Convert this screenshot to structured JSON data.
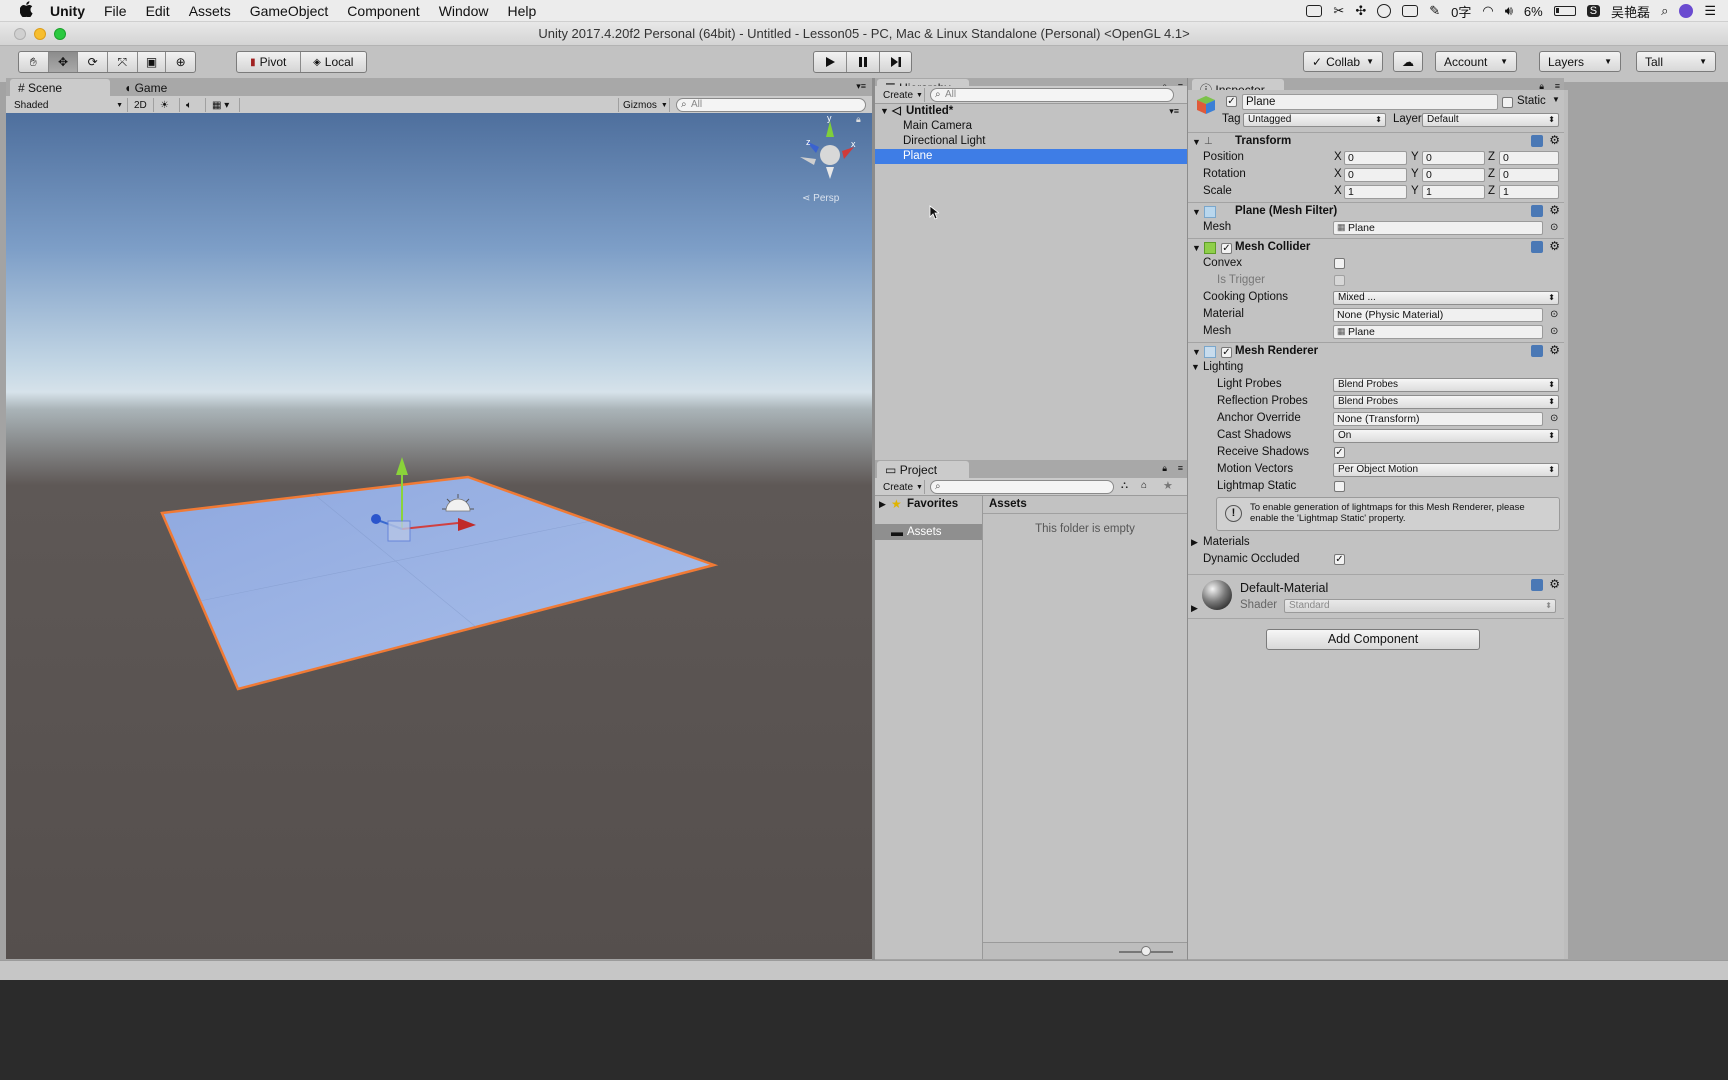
{
  "menubar": {
    "apple": "",
    "items": [
      "Unity",
      "File",
      "Edit",
      "Assets",
      "GameObject",
      "Component",
      "Window",
      "Help"
    ],
    "status": {
      "ime": "0字",
      "battery": "6%",
      "user": "吴艳磊"
    }
  },
  "window": {
    "title": "Unity 2017.4.20f2 Personal (64bit) - Untitled - Lesson05 - PC, Mac & Linux Standalone (Personal) <OpenGL 4.1>"
  },
  "toolbar": {
    "tools": [
      "hand-tool-icon",
      "move-tool-icon",
      "rotate-tool-icon",
      "scale-tool-icon",
      "rect-tool-icon",
      "transform-tool-icon"
    ],
    "pivot": "Pivot",
    "local": "Local",
    "collab": "Collab",
    "account": "Account",
    "layers": "Layers",
    "layout": "Tall"
  },
  "scene": {
    "tabs": [
      "Scene",
      "Game"
    ],
    "shading": "Shaded",
    "mode2d": "2D",
    "gizmos": "Gizmos",
    "search_placeholder": "All",
    "persp_label": "Persp",
    "gizmo_axes": {
      "y": "y",
      "x": "x",
      "z": "z"
    }
  },
  "hierarchy": {
    "tab": "Hierarchy",
    "create": "Create",
    "search_placeholder": "All",
    "scene_name": "Untitled*",
    "items": [
      "Main Camera",
      "Directional Light",
      "Plane"
    ],
    "selected": "Plane"
  },
  "project": {
    "tab": "Project",
    "create": "Create",
    "favorites": "Favorites",
    "assets_tree": "Assets",
    "assets_header": "Assets",
    "empty_text": "This folder is empty"
  },
  "inspector": {
    "tab": "Inspector",
    "object_name": "Plane",
    "static_label": "Static",
    "tag_label": "Tag",
    "tag_value": "Untagged",
    "layer_label": "Layer",
    "layer_value": "Default",
    "transform": {
      "title": "Transform",
      "rows": [
        {
          "label": "Position",
          "x": "0",
          "y": "0",
          "z": "0"
        },
        {
          "label": "Rotation",
          "x": "0",
          "y": "0",
          "z": "0"
        },
        {
          "label": "Scale",
          "x": "1",
          "y": "1",
          "z": "1"
        }
      ],
      "axes": [
        "X",
        "Y",
        "Z"
      ]
    },
    "mesh_filter": {
      "title": "Plane (Mesh Filter)",
      "mesh_label": "Mesh",
      "mesh_value": "Plane"
    },
    "mesh_collider": {
      "title": "Mesh Collider",
      "convex": "Convex",
      "is_trigger": "Is Trigger",
      "cooking_label": "Cooking Options",
      "cooking_value": "Mixed ...",
      "material_label": "Material",
      "material_value": "None (Physic Material)",
      "mesh_label": "Mesh",
      "mesh_value": "Plane"
    },
    "mesh_renderer": {
      "title": "Mesh Renderer",
      "lighting": "Lighting",
      "light_probes_label": "Light Probes",
      "light_probes_value": "Blend Probes",
      "reflection_probes_label": "Reflection Probes",
      "reflection_probes_value": "Blend Probes",
      "anchor_label": "Anchor Override",
      "anchor_value": "None (Transform)",
      "cast_label": "Cast Shadows",
      "cast_value": "On",
      "receive_label": "Receive Shadows",
      "motion_label": "Motion Vectors",
      "motion_value": "Per Object Motion",
      "lightmap_label": "Lightmap Static",
      "info": "To enable generation of lightmaps for this Mesh Renderer, please enable the 'Lightmap Static' property.",
      "materials": "Materials",
      "dynamic_label": "Dynamic Occluded"
    },
    "material": {
      "name": "Default-Material",
      "shader_label": "Shader",
      "shader_value": "Standard"
    },
    "add_component": "Add Component"
  }
}
